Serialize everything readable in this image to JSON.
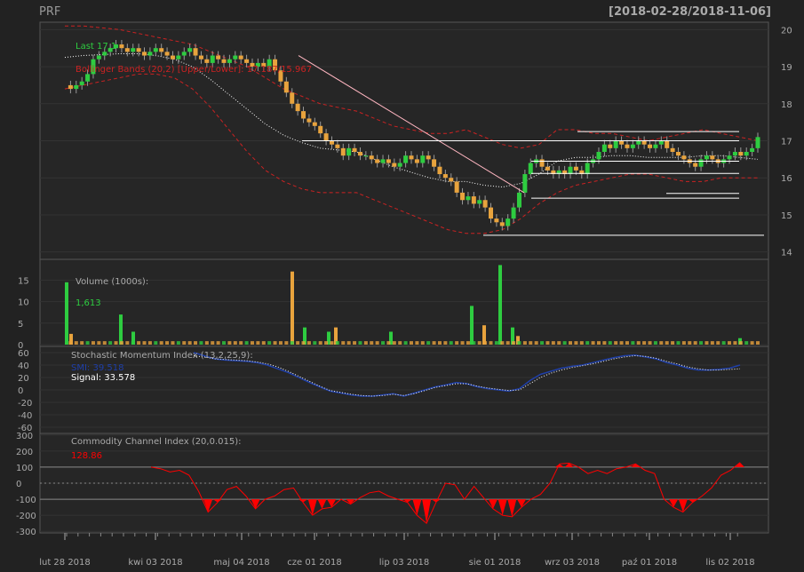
{
  "header": {
    "symbol": "PRF",
    "range": "[2018-02-28/2018-11-06]"
  },
  "colors": {
    "background": "#222222",
    "panel": "#262626",
    "border": "#555555",
    "grid": "#333333",
    "up_candle": "#2ecc40",
    "down_candle": "#e8a33d",
    "text": "#aaaaaa",
    "last_label": "#2ecc40",
    "bbands": "#cc2222",
    "smi": "#1f3fa8",
    "signal": "#ffffff",
    "cci_fill": "#ff0000",
    "trendline": "#ffffff",
    "downtrend": "#ffb6c1"
  },
  "price_panel": {
    "last_label": "Last 17.1",
    "bbands_label": "Bollinger Bands (20,2) [Upper/Lower]: 17.187/15.967",
    "ticks": [
      "20",
      "19",
      "18",
      "17",
      "16",
      "15",
      "14"
    ]
  },
  "volume_panel": {
    "label": "Volume (1000s):",
    "value": "1,613",
    "ticks": [
      "15",
      "10",
      "5",
      "0"
    ]
  },
  "smi_panel": {
    "label": "Stochastic Momentum Index (13,2,25,9):",
    "smi_value": "SMI: 39.518",
    "signal_value": "Signal: 33.578",
    "ticks": [
      "60",
      "40",
      "20",
      "0",
      "-20",
      "-40",
      "-60"
    ]
  },
  "cci_panel": {
    "label": "Commodity Channel Index (20,0.015):",
    "value": "128.86",
    "ticks": [
      "300",
      "200",
      "100",
      "0",
      "-100",
      "-200",
      "-300"
    ]
  },
  "x_axis": {
    "labels": [
      "lut 28 2018",
      "kwi 03 2018",
      "maj 04 2018",
      "cze 01 2018",
      "lip 03 2018",
      "sie 01 2018",
      "wrz 03 2018",
      "paź 01 2018",
      "lis 02 2018"
    ]
  },
  "chart_data": {
    "type": "candlestick",
    "x_range": [
      "2018-02-28",
      "2018-11-06"
    ],
    "price_ylim": [
      13.8,
      20.2
    ],
    "price_path": [
      18.5,
      18.4,
      18.5,
      18.6,
      18.8,
      19.2,
      19.3,
      19.4,
      19.5,
      19.6,
      19.5,
      19.4,
      19.5,
      19.4,
      19.3,
      19.4,
      19.5,
      19.4,
      19.3,
      19.2,
      19.3,
      19.4,
      19.5,
      19.3,
      19.2,
      19.1,
      19.3,
      19.2,
      19.1,
      19.2,
      19.3,
      19.2,
      19.1,
      19.0,
      19.1,
      19.0,
      19.2,
      18.9,
      18.6,
      18.3,
      18.0,
      17.8,
      17.6,
      17.5,
      17.4,
      17.2,
      17.0,
      16.9,
      16.8,
      16.6,
      16.8,
      16.7,
      16.6,
      16.6,
      16.5,
      16.4,
      16.5,
      16.4,
      16.3,
      16.4,
      16.6,
      16.5,
      16.4,
      16.6,
      16.5,
      16.3,
      16.1,
      16.0,
      15.9,
      15.6,
      15.4,
      15.5,
      15.3,
      15.4,
      15.2,
      14.9,
      14.8,
      14.7,
      14.9,
      15.2,
      15.6,
      16.1,
      16.4,
      16.5,
      16.3,
      16.2,
      16.1,
      16.2,
      16.1,
      16.3,
      16.2,
      16.1,
      16.4,
      16.5,
      16.7,
      16.9,
      16.8,
      17.0,
      16.9,
      16.8,
      16.9,
      17.0,
      16.9,
      16.8,
      16.9,
      17.0,
      16.8,
      16.7,
      16.6,
      16.5,
      16.4,
      16.3,
      16.5,
      16.6,
      16.5,
      16.4,
      16.5,
      16.6,
      16.7,
      16.6,
      16.7,
      16.8,
      17.1
    ],
    "bb_upper": [
      20.1,
      20.1,
      20.05,
      20.0,
      19.9,
      19.8,
      19.7,
      19.6,
      19.4,
      19.2,
      19.0,
      18.7,
      18.4,
      18.2,
      18.0,
      17.9,
      17.8,
      17.6,
      17.4,
      17.3,
      17.2,
      17.2,
      17.3,
      17.1,
      16.9,
      16.8,
      16.9,
      17.3,
      17.3,
      17.2,
      17.2,
      17.1,
      17.0,
      17.1,
      17.2,
      17.3,
      17.2,
      17.1,
      17.0
    ],
    "bb_lower": [
      18.4,
      18.5,
      18.6,
      18.7,
      18.8,
      18.8,
      18.7,
      18.4,
      17.9,
      17.3,
      16.7,
      16.2,
      15.9,
      15.7,
      15.6,
      15.6,
      15.6,
      15.4,
      15.2,
      15.0,
      14.8,
      14.6,
      14.5,
      14.5,
      14.6,
      14.9,
      15.3,
      15.6,
      15.8,
      15.9,
      16.0,
      16.1,
      16.1,
      16.0,
      15.9,
      15.9,
      16.0,
      16.0,
      16.0
    ],
    "horizontal_levels": [
      17.25,
      17.0,
      16.45,
      16.12,
      15.58,
      15.45,
      14.45
    ],
    "downtrend_line": [
      [
        19.3,
        "2018-05-15"
      ],
      [
        15.6,
        "2018-08-01"
      ]
    ],
    "volume_peaks_k": [
      14.5,
      2.5,
      7,
      3,
      17,
      4,
      3,
      4,
      3,
      9,
      4.5,
      18.5,
      4,
      2,
      1.5
    ],
    "smi_path": [
      60,
      55,
      50,
      48,
      47,
      46,
      44,
      40,
      34,
      28,
      20,
      12,
      5,
      -2,
      -5,
      -8,
      -10,
      -10,
      -8,
      -6,
      -10,
      -5,
      0,
      5,
      8,
      12,
      10,
      5,
      2,
      0,
      -2,
      2,
      15,
      25,
      30,
      35,
      38,
      40,
      44,
      48,
      52,
      55,
      56,
      53,
      50,
      44,
      40,
      35,
      32,
      32,
      33,
      35,
      40
    ],
    "signal_path": [
      55,
      53,
      50,
      49,
      48,
      47,
      45,
      42,
      37,
      30,
      22,
      14,
      6,
      -1,
      -4,
      -7,
      -9,
      -10,
      -9,
      -7,
      -9,
      -6,
      -1,
      4,
      7,
      10,
      10,
      6,
      3,
      1,
      -1,
      0,
      10,
      20,
      27,
      32,
      36,
      39,
      42,
      46,
      50,
      53,
      55,
      54,
      51,
      46,
      42,
      37,
      34,
      32,
      32,
      33,
      34
    ],
    "cci_path": [
      100,
      90,
      70,
      80,
      50,
      -50,
      -180,
      -120,
      -40,
      -20,
      -80,
      -160,
      -100,
      -80,
      -40,
      -30,
      -120,
      -200,
      -160,
      -150,
      -100,
      -130,
      -90,
      -60,
      -50,
      -80,
      -100,
      -120,
      -200,
      -250,
      -120,
      0,
      -10,
      -100,
      -20,
      -90,
      -160,
      -200,
      -210,
      -150,
      -100,
      -70,
      0,
      120,
      125,
      100,
      60,
      80,
      60,
      90,
      100,
      120,
      80,
      60,
      -100,
      -150,
      -180,
      -120,
      -80,
      -30,
      50,
      80,
      129
    ]
  }
}
